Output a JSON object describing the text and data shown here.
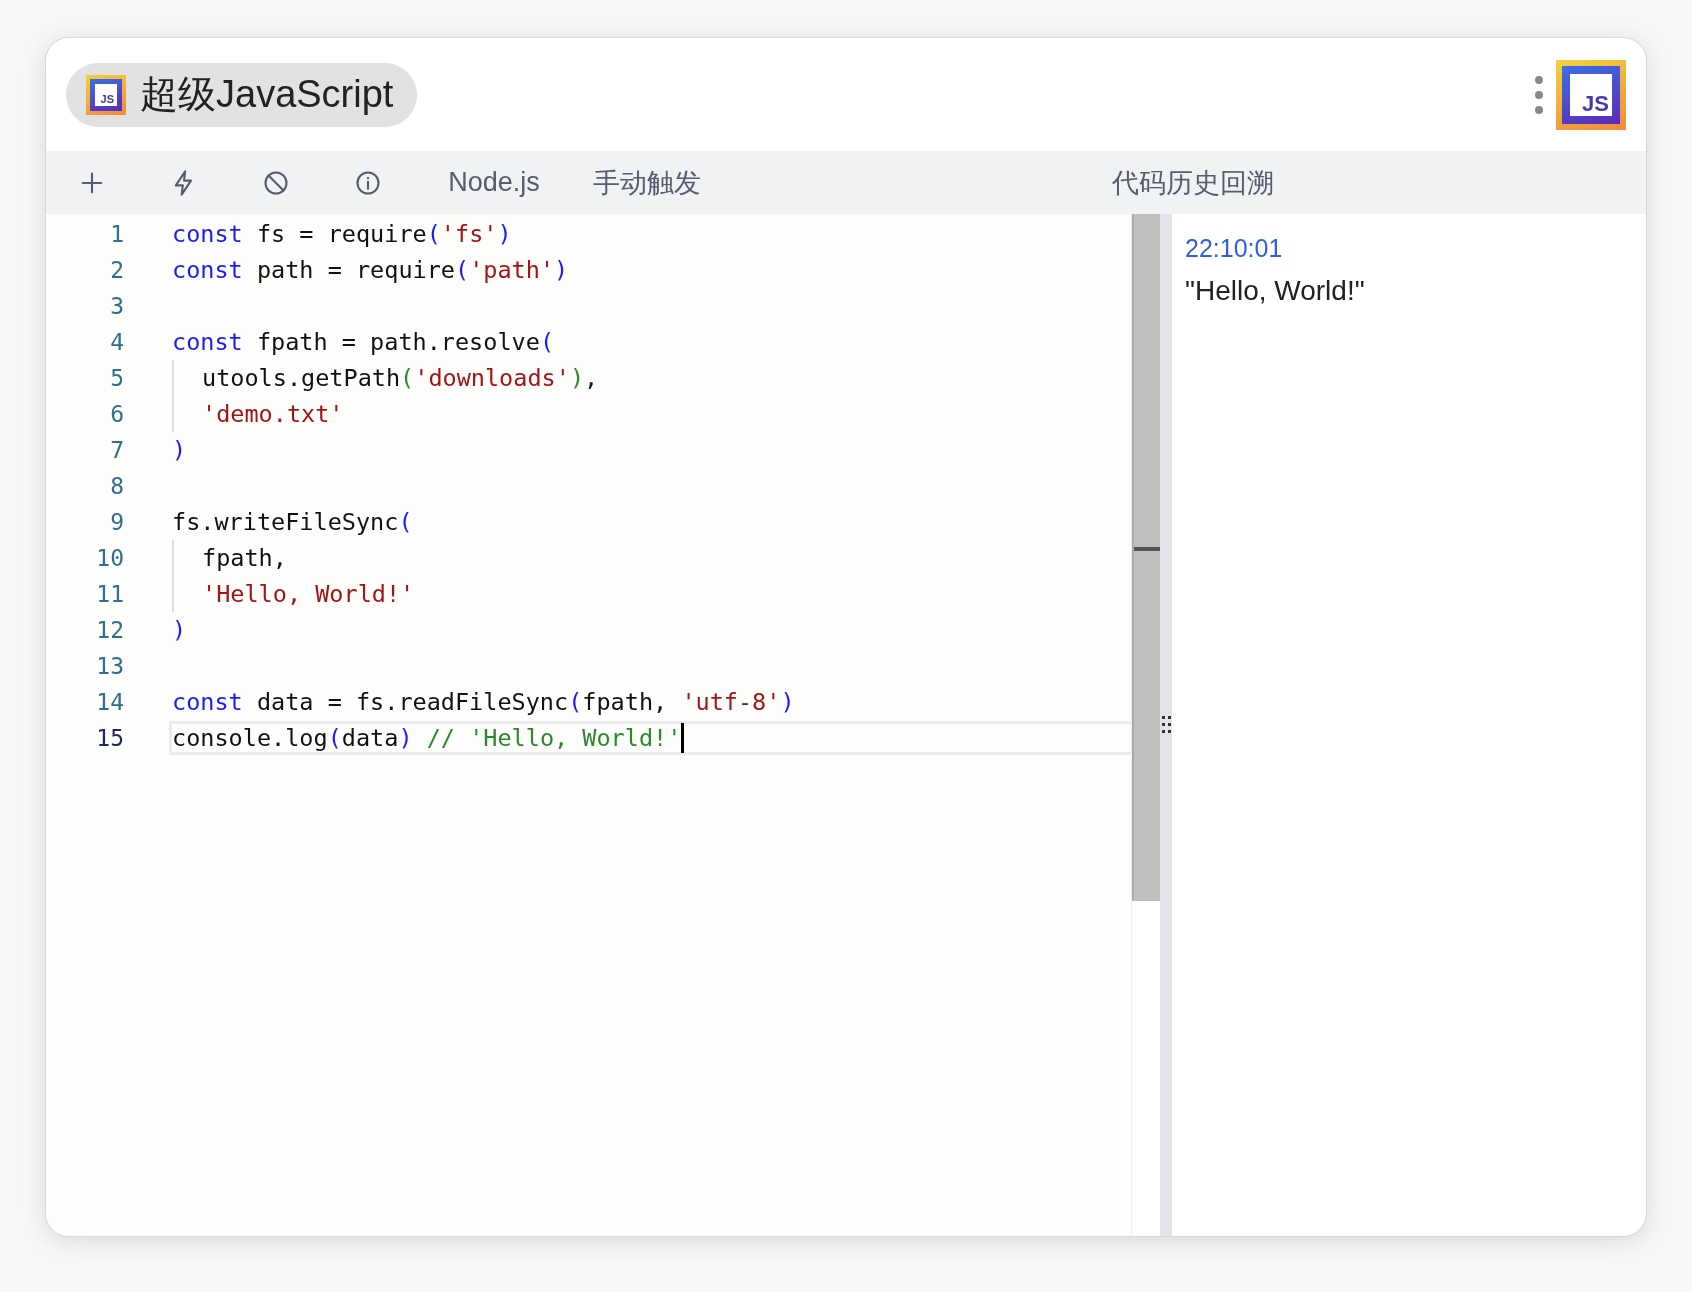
{
  "header": {
    "title": "超级JavaScript",
    "logo_text": "JS",
    "app_icon_text": "JS"
  },
  "toolbar": {
    "items": [
      {
        "kind": "plus"
      },
      {
        "kind": "bolt"
      },
      {
        "kind": "ban"
      },
      {
        "kind": "info"
      },
      {
        "kind": "text",
        "label": "Node.js"
      },
      {
        "kind": "text",
        "label": "手动触发"
      }
    ],
    "history_title": "代码历史回溯"
  },
  "editor": {
    "lines": [
      {
        "number": "1",
        "selected": false,
        "indented": false,
        "tokens": [
          {
            "kind": "keyword",
            "text": "const"
          },
          {
            "kind": "plain",
            "text": " fs = "
          },
          {
            "kind": "plain",
            "text": "require"
          },
          {
            "kind": "paren",
            "text": "("
          },
          {
            "kind": "string",
            "text": "'fs'"
          },
          {
            "kind": "paren",
            "text": ")"
          }
        ]
      },
      {
        "number": "2",
        "selected": false,
        "indented": false,
        "tokens": [
          {
            "kind": "keyword",
            "text": "const"
          },
          {
            "kind": "plain",
            "text": " path = require"
          },
          {
            "kind": "paren",
            "text": "("
          },
          {
            "kind": "string",
            "text": "'path'"
          },
          {
            "kind": "paren",
            "text": ")"
          }
        ]
      },
      {
        "number": "3",
        "selected": false,
        "indented": false
      },
      {
        "number": "4",
        "selected": false,
        "indented": false,
        "tokens": [
          {
            "kind": "keyword",
            "text": "const"
          },
          {
            "kind": "plain",
            "text": " fpath = path.resolve"
          },
          {
            "kind": "paren",
            "text": "("
          }
        ]
      },
      {
        "number": "5",
        "selected": false,
        "indented": true,
        "tokens": [
          {
            "kind": "plain",
            "text": "utools.getPath"
          },
          {
            "kind": "paren2",
            "text": "("
          },
          {
            "kind": "string",
            "text": "'downloads'"
          },
          {
            "kind": "paren2",
            "text": ")"
          },
          {
            "kind": "plain",
            "text": ","
          }
        ]
      },
      {
        "number": "6",
        "selected": false,
        "indented": true,
        "tokens": [
          {
            "kind": "string",
            "text": "'demo.txt'"
          }
        ]
      },
      {
        "number": "7",
        "selected": false,
        "indented": false,
        "tokens": [
          {
            "kind": "paren",
            "text": ")"
          }
        ]
      },
      {
        "number": "8",
        "selected": false,
        "indented": false
      },
      {
        "number": "9",
        "selected": false,
        "indented": false,
        "tokens": [
          {
            "kind": "plain",
            "text": "fs.writeFileSync"
          },
          {
            "kind": "paren",
            "text": "("
          }
        ]
      },
      {
        "number": "10",
        "selected": false,
        "indented": true,
        "tokens": [
          {
            "kind": "plain",
            "text": "fpath,"
          }
        ]
      },
      {
        "number": "11",
        "selected": false,
        "indented": true,
        "tokens": [
          {
            "kind": "string",
            "text": "'Hello, World!'"
          }
        ]
      },
      {
        "number": "12",
        "selected": false,
        "indented": false,
        "tokens": [
          {
            "kind": "paren",
            "text": ")"
          }
        ]
      },
      {
        "number": "13",
        "selected": false,
        "indented": false
      },
      {
        "number": "14",
        "selected": false,
        "indented": false,
        "tokens": [
          {
            "kind": "keyword",
            "text": "const"
          },
          {
            "kind": "plain",
            "text": " data = fs.readFileSync"
          },
          {
            "kind": "paren",
            "text": "("
          },
          {
            "kind": "plain",
            "text": "fpath, "
          },
          {
            "kind": "string",
            "text": "'utf-8'"
          },
          {
            "kind": "paren",
            "text": ")"
          }
        ]
      },
      {
        "number": "15",
        "selected": true,
        "indented": false,
        "tokens": [
          {
            "kind": "plain",
            "text": "console.log"
          },
          {
            "kind": "paren",
            "text": "("
          },
          {
            "kind": "plain",
            "text": "data"
          },
          {
            "kind": "paren",
            "text": ")"
          },
          {
            "kind": "comment",
            "text": " // 'Hello, World!'"
          }
        ]
      }
    ]
  },
  "history": [
    {
      "time": "22:10:01",
      "output": "\"Hello, World!\""
    }
  ]
}
